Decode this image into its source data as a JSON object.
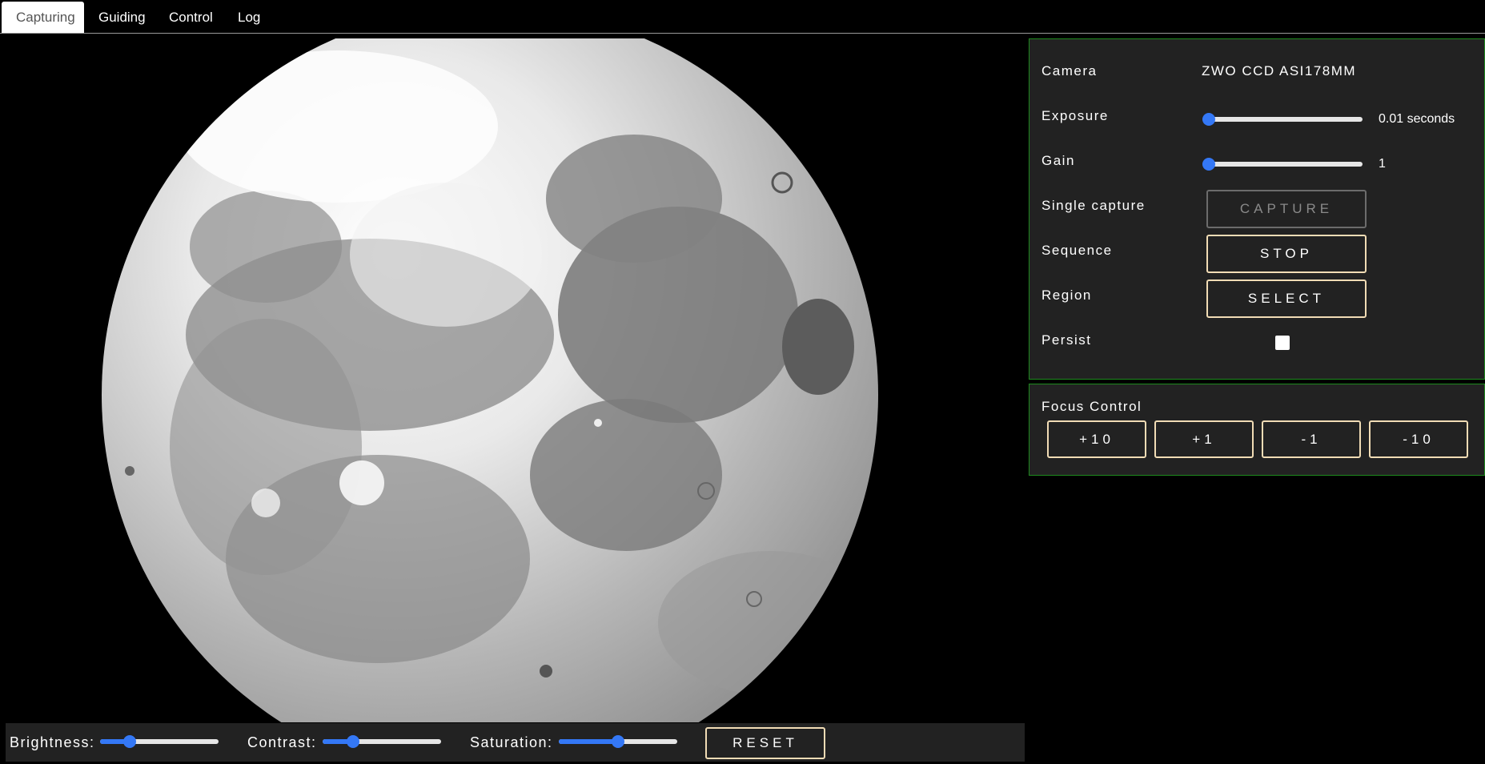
{
  "tabs": [
    {
      "label": "Capturing",
      "active": true
    },
    {
      "label": "Guiding",
      "active": false
    },
    {
      "label": "Control",
      "active": false
    },
    {
      "label": "Log",
      "active": false
    }
  ],
  "camera_panel": {
    "camera": {
      "label": "Camera",
      "value": "ZWO CCD ASI178MM"
    },
    "exposure": {
      "label": "Exposure",
      "value_text": "0.01 seconds",
      "level": 0.0
    },
    "gain": {
      "label": "Gain",
      "value_text": "1",
      "level": 0.0
    },
    "single_capture": {
      "label": "Single capture",
      "button": "CAPTURE",
      "disabled": true
    },
    "sequence": {
      "label": "Sequence",
      "button": "STOP"
    },
    "region": {
      "label": "Region",
      "button": "SELECT"
    },
    "persist": {
      "label": "Persist",
      "checked": false
    }
  },
  "focus_panel": {
    "title": "Focus Control",
    "buttons": [
      "+10",
      "+1",
      "-1",
      "-10"
    ]
  },
  "adjustments": {
    "brightness": {
      "label": "Brightness:",
      "level": 0.22
    },
    "contrast": {
      "label": "Contrast:",
      "level": 0.23
    },
    "saturation": {
      "label": "Saturation:",
      "level": 0.5
    },
    "reset": "RESET"
  },
  "colors": {
    "accent": "#3478f6",
    "panel_border": "#1e8a1e",
    "button_border": "#f1dcb5",
    "panel_bg": "#222222"
  },
  "icons": {
    "image": "moon-image"
  }
}
